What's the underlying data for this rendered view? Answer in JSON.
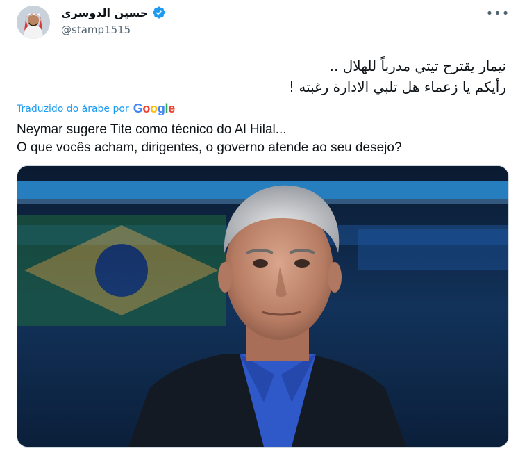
{
  "tweet": {
    "author_name": "حسين الدوسري",
    "handle": "@stamp1515",
    "more_label": "•••",
    "original_text_line1": "نيمار يقترح تيتي مدرباً للهلال ..",
    "original_text_line2": "رأيكم يا زعماء هل تلبي الادارة رغبته !",
    "translated_by_label": "Traduzido do árabe por",
    "translation_provider": "Google",
    "translated_line1": "Neymar sugere Tite como técnico do Al Hilal...",
    "translated_line2": "O que vocês acham, dirigentes, o governo atende ao seu desejo?"
  },
  "colors": {
    "accent": "#1d9bf0",
    "text": "#0f1419",
    "secondary": "#536471"
  },
  "icons": {
    "verified": "verified-badge-icon",
    "more": "more-horizontal-icon",
    "google": "google-logo"
  }
}
